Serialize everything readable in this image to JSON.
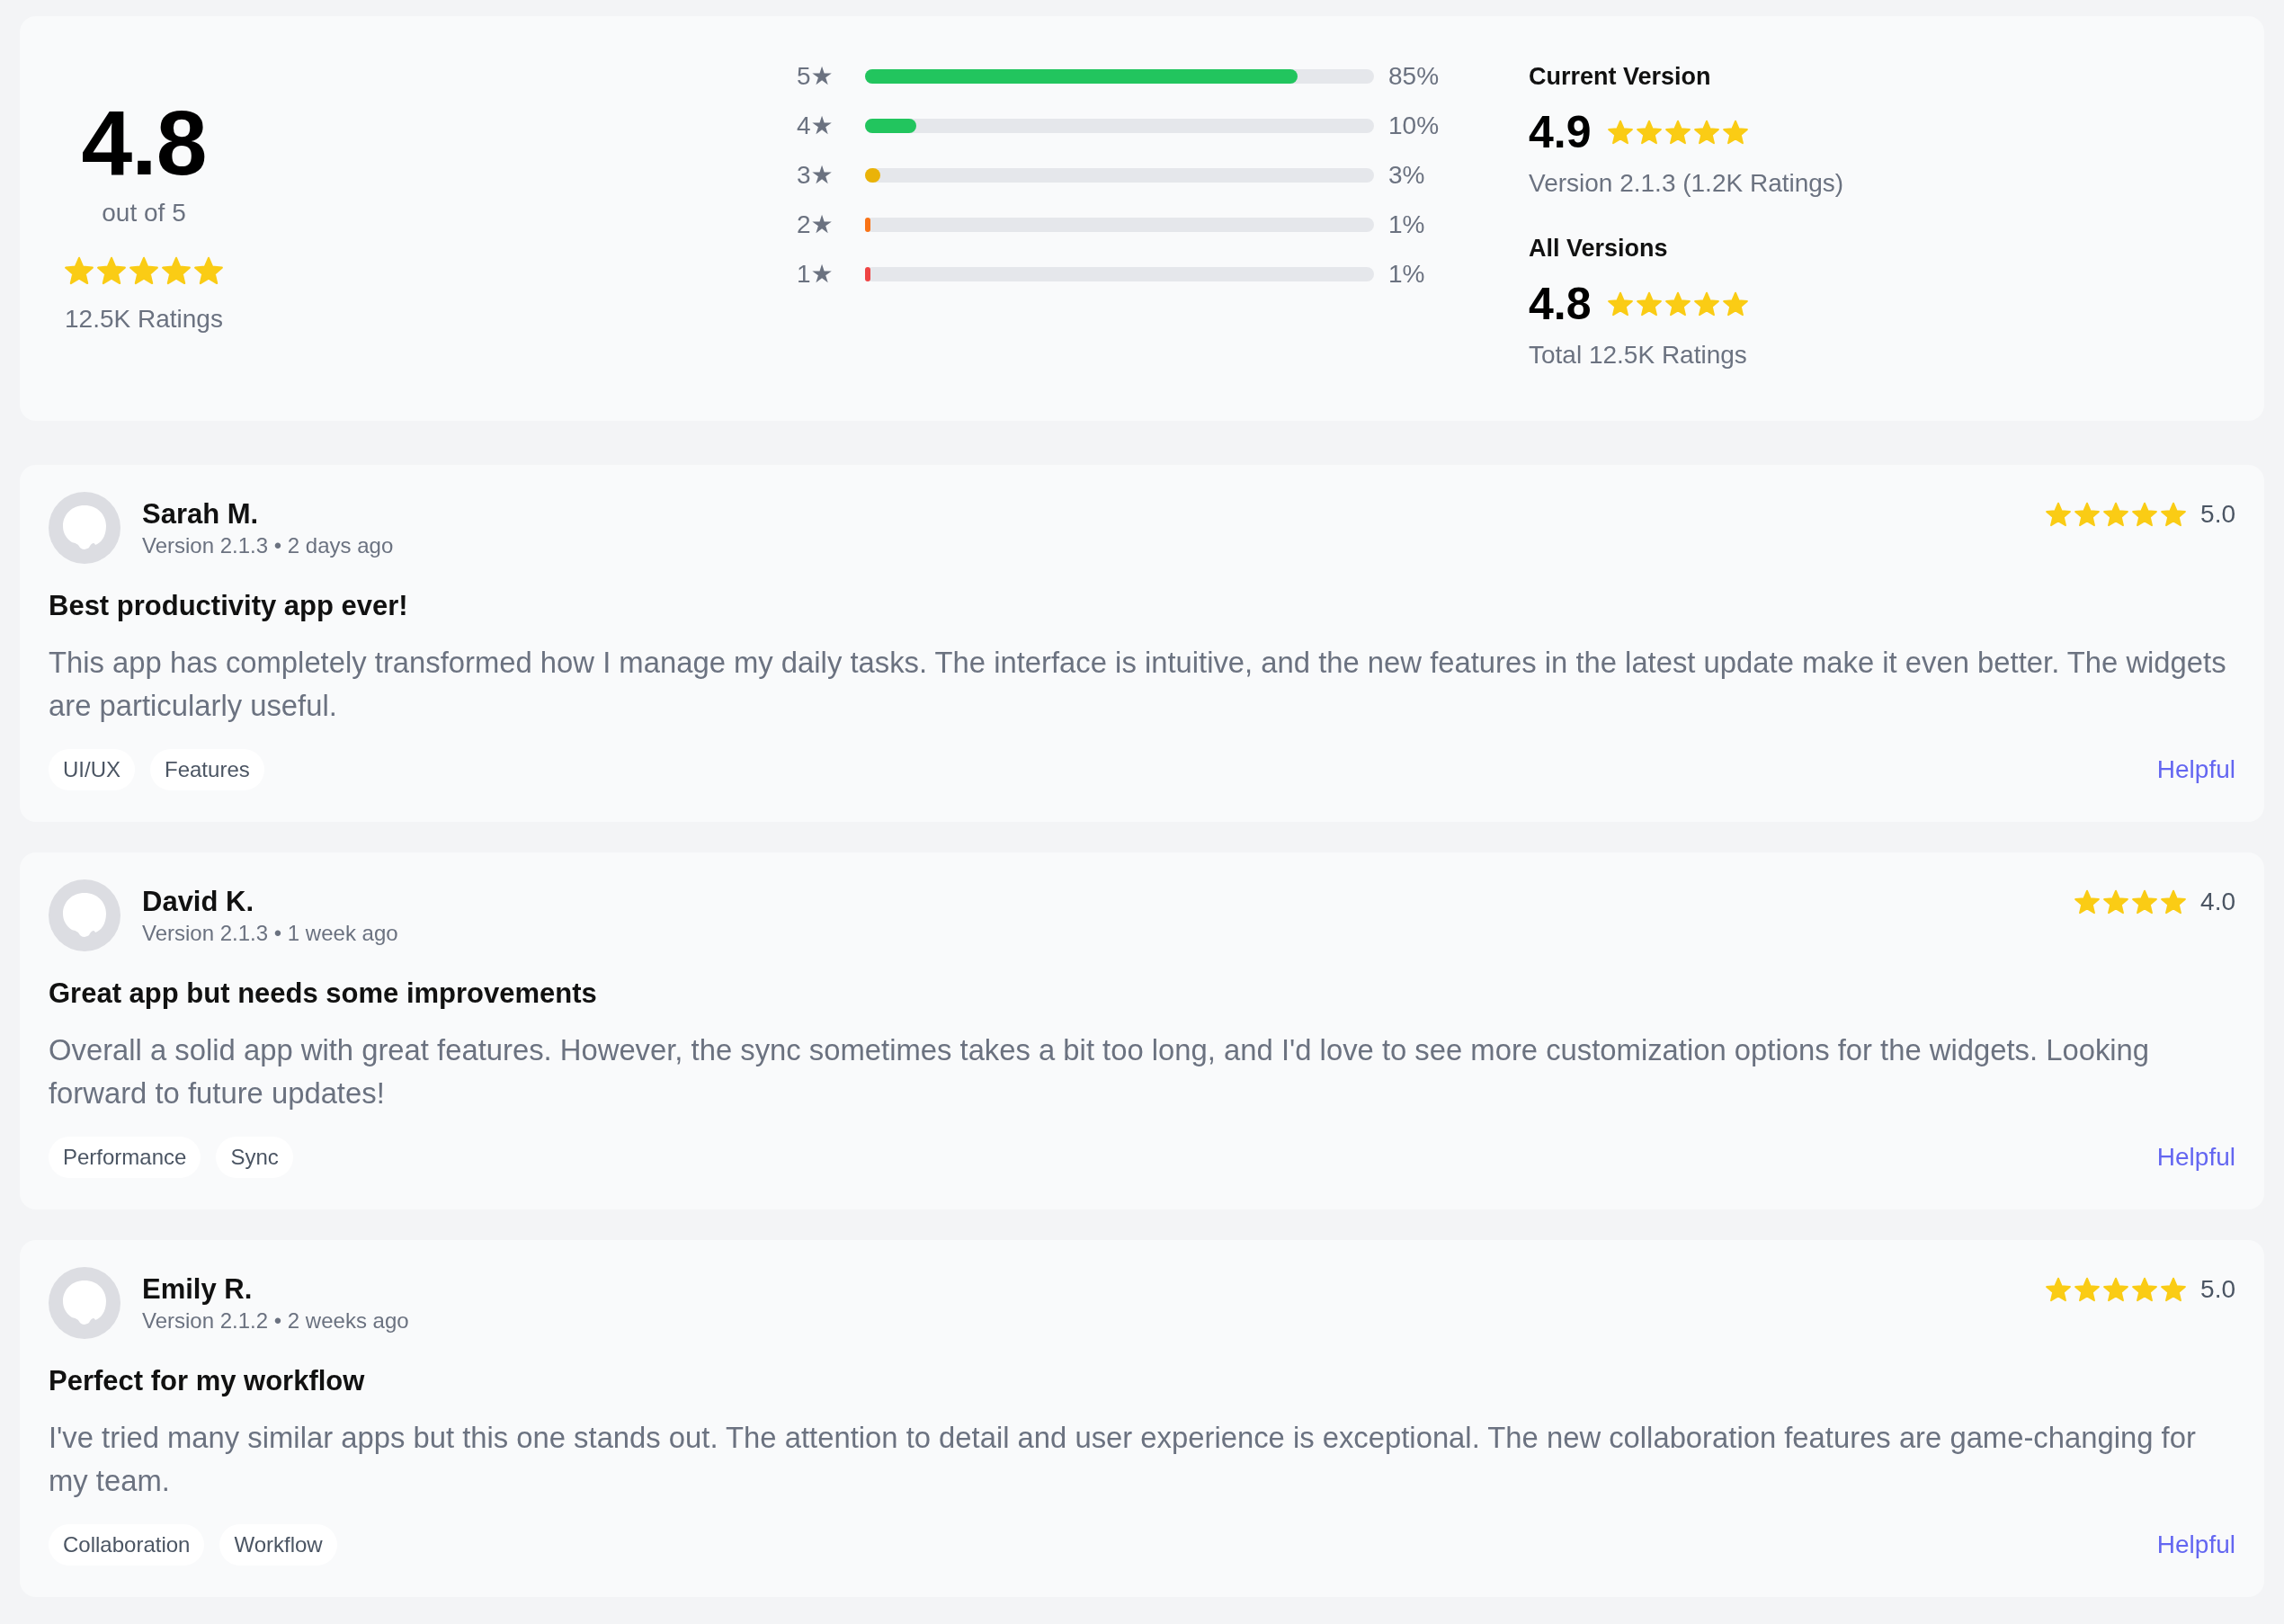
{
  "summary": {
    "overall": {
      "score": "4.8",
      "caption": "out of 5",
      "stars": 5,
      "count": "12.5K Ratings"
    },
    "distribution": [
      {
        "label": "5★",
        "level": 0.85,
        "reading": "85%",
        "color": "#22c55e"
      },
      {
        "label": "4★",
        "level": 0.1,
        "reading": "10%",
        "color": "#22c55e"
      },
      {
        "label": "3★",
        "level": 0.03,
        "reading": "3%",
        "color": "#eab308"
      },
      {
        "label": "2★",
        "level": 0.01,
        "reading": "1%",
        "color": "#f97316"
      },
      {
        "label": "1★",
        "level": 0.01,
        "reading": "1%",
        "color": "#ef4444"
      }
    ],
    "versions": [
      {
        "heading": "Current Version",
        "score": "4.9",
        "stars": 5,
        "detail": "Version 2.1.3 (1.2K Ratings)"
      },
      {
        "heading": "All Versions",
        "score": "4.8",
        "stars": 5,
        "detail": "Total 12.5K Ratings"
      }
    ]
  },
  "reviews": [
    {
      "name": "Sarah M.",
      "meta": "Version 2.1.3 • 2 days ago",
      "stars": 5,
      "score": "5.0",
      "title": "Best productivity app ever!",
      "body": "This app has completely transformed how I manage my daily tasks. The interface is intuitive, and the new features in the latest update make it even better. The widgets are particularly useful.",
      "tags": [
        "UI/UX",
        "Features"
      ],
      "action": "Helpful"
    },
    {
      "name": "David K.",
      "meta": "Version 2.1.3 • 1 week ago",
      "stars": 4,
      "score": "4.0",
      "title": "Great app but needs some improvements",
      "body": "Overall a solid app with great features. However, the sync sometimes takes a bit too long, and I'd love to see more customization options for the widgets. Looking forward to future updates!",
      "tags": [
        "Performance",
        "Sync"
      ],
      "action": "Helpful"
    },
    {
      "name": "Emily R.",
      "meta": "Version 2.1.2 • 2 weeks ago",
      "stars": 5,
      "score": "5.0",
      "title": "Perfect for my workflow",
      "body": "I've tried many similar apps but this one stands out. The attention to detail and user experience is exceptional. The new collaboration features are game-changing for my team.",
      "tags": [
        "Collaboration",
        "Workflow"
      ],
      "action": "Helpful"
    }
  ]
}
